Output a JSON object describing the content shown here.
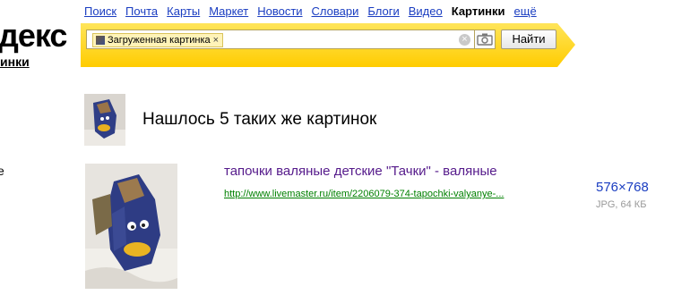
{
  "logo": {
    "main": "декс",
    "sub": "инки"
  },
  "left_mark": "е",
  "nav": {
    "items": [
      "Поиск",
      "Почта",
      "Карты",
      "Маркет",
      "Новости",
      "Словари",
      "Блоги",
      "Видео"
    ],
    "active": "Картинки",
    "more": "ещё"
  },
  "search": {
    "chip_label": "Загруженная картинка",
    "chip_close": "×",
    "clear": "×",
    "button": "Найти"
  },
  "summary": {
    "title": "Нашлось 5 таких же картинок"
  },
  "result": {
    "title": "тапочки валяные детские \"Тачки\" - валяные",
    "url": "http://www.livemaster.ru/item/2206079-374-tapochki-valyanye-...",
    "size": "576×768",
    "meta": "JPG, 64 КБ"
  }
}
